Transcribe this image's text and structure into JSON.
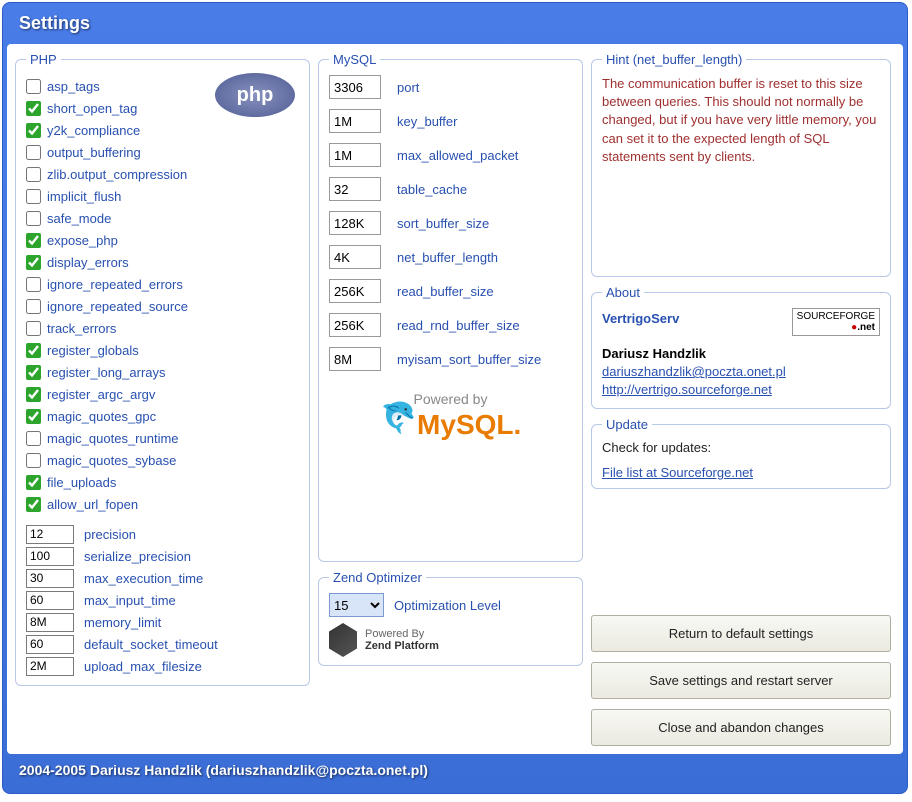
{
  "window": {
    "title": "Settings"
  },
  "footer": "2004-2005 Dariusz Handzlik (dariuszhandzlik@poczta.onet.pl)",
  "php": {
    "legend": "PHP",
    "logo": "php",
    "checks": [
      {
        "label": "asp_tags",
        "checked": false
      },
      {
        "label": "short_open_tag",
        "checked": true
      },
      {
        "label": "y2k_compliance",
        "checked": true
      },
      {
        "label": "output_buffering",
        "checked": false
      },
      {
        "label": "zlib.output_compression",
        "checked": false
      },
      {
        "label": "implicit_flush",
        "checked": false
      },
      {
        "label": "safe_mode",
        "checked": false
      },
      {
        "label": "expose_php",
        "checked": true
      },
      {
        "label": "display_errors",
        "checked": true
      },
      {
        "label": "ignore_repeated_errors",
        "checked": false
      },
      {
        "label": "ignore_repeated_source",
        "checked": false
      },
      {
        "label": "track_errors",
        "checked": false
      },
      {
        "label": "register_globals",
        "checked": true
      },
      {
        "label": "register_long_arrays",
        "checked": true
      },
      {
        "label": "register_argc_argv",
        "checked": true
      },
      {
        "label": "magic_quotes_gpc",
        "checked": true
      },
      {
        "label": "magic_quotes_runtime",
        "checked": false
      },
      {
        "label": "magic_quotes_sybase",
        "checked": false
      },
      {
        "label": "file_uploads",
        "checked": true
      },
      {
        "label": "allow_url_fopen",
        "checked": true
      }
    ],
    "texts": [
      {
        "value": "12",
        "label": "precision"
      },
      {
        "value": "100",
        "label": "serialize_precision"
      },
      {
        "value": "30",
        "label": "max_execution_time"
      },
      {
        "value": "60",
        "label": "max_input_time"
      },
      {
        "value": "8M",
        "label": "memory_limit"
      },
      {
        "value": "60",
        "label": "default_socket_timeout"
      },
      {
        "value": "2M",
        "label": "upload_max_filesize"
      }
    ]
  },
  "mysql": {
    "legend": "MySQL",
    "logo_powered": "Powered by",
    "logo_text": "MySQL",
    "rows": [
      {
        "value": "3306",
        "label": "port"
      },
      {
        "value": "1M",
        "label": "key_buffer"
      },
      {
        "value": "1M",
        "label": "max_allowed_packet"
      },
      {
        "value": "32",
        "label": "table_cache"
      },
      {
        "value": "128K",
        "label": "sort_buffer_size"
      },
      {
        "value": "4K",
        "label": "net_buffer_length"
      },
      {
        "value": "256K",
        "label": "read_buffer_size"
      },
      {
        "value": "256K",
        "label": "read_rnd_buffer_size"
      },
      {
        "value": "8M",
        "label": "myisam_sort_buffer_size"
      }
    ]
  },
  "zend": {
    "legend": "Zend Optimizer",
    "level_label": "Optimization Level",
    "level_value": "15",
    "powered1": "Powered By",
    "powered2": "Zend Platform"
  },
  "hint": {
    "legend": "Hint (net_buffer_length)",
    "text": "The communication buffer is reset to this size between queries. This should not normally be changed, but if you have very little memory, you can set it to the expected length of SQL statements sent by clients."
  },
  "about": {
    "legend": "About",
    "product": "VertrigoServ",
    "author": "Dariusz Handzlik",
    "email": "dariuszhandzlik@poczta.onet.pl",
    "url": "http://vertrigo.sourceforge.net",
    "sf1": "SOURCEFORGE",
    "sf2": ".net"
  },
  "update": {
    "legend": "Update",
    "label": "Check for updates:",
    "link": "File list at Sourceforge.net"
  },
  "buttons": {
    "defaults": "Return to default settings",
    "save": "Save settings and restart server",
    "close": "Close and abandon changes"
  }
}
